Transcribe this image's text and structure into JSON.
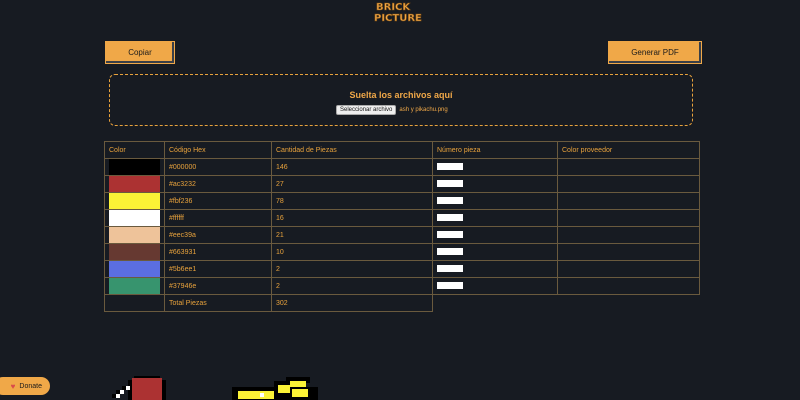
{
  "brand": {
    "logo_line1": "BRICK",
    "logo_line2": "PICTURE"
  },
  "toolbar": {
    "copy_label": "Copiar",
    "pdf_label": "Generar PDF"
  },
  "dropzone": {
    "title": "Suelta los archivos aquí",
    "file_button": "Seleccionar archivo",
    "file_name": "ash y pikachu.png"
  },
  "table": {
    "headers": [
      "Color",
      "Código Hex",
      "Cantidad de Piezas",
      "Número pieza",
      "Color proveedor"
    ],
    "rows": [
      {
        "hex": "#000000",
        "count": "146",
        "color": "#000000"
      },
      {
        "hex": "#ac3232",
        "count": "27",
        "color": "#ac3232"
      },
      {
        "hex": "#fbf236",
        "count": "78",
        "color": "#fbf236"
      },
      {
        "hex": "#ffffff",
        "count": "16",
        "color": "#ffffff"
      },
      {
        "hex": "#eec39a",
        "count": "21",
        "color": "#eec39a"
      },
      {
        "hex": "#663931",
        "count": "10",
        "color": "#663931"
      },
      {
        "hex": "#5b6ee1",
        "count": "2",
        "color": "#5b6ee1"
      },
      {
        "hex": "#37946e",
        "count": "2",
        "color": "#37946e"
      }
    ],
    "total_label": "Total Piezas",
    "total_value": "302"
  },
  "donate": {
    "label": "Donate",
    "icon": "heart-icon"
  },
  "theme": {
    "background": "#171b22",
    "accent": "#e8a23c",
    "button": "#f0a848"
  }
}
